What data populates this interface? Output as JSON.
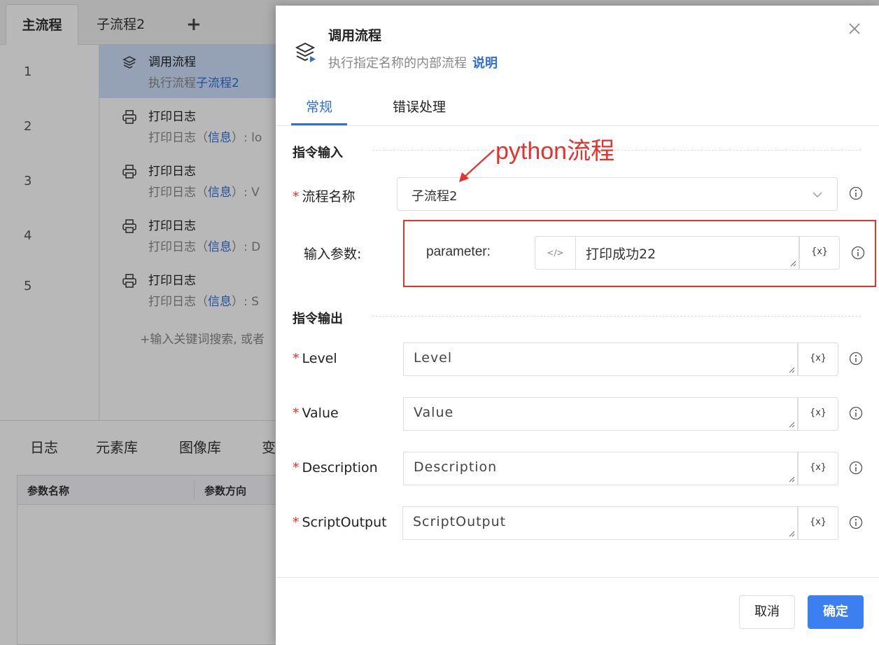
{
  "tabs": {
    "main": "主流程",
    "sub": "子流程2",
    "add": "+"
  },
  "line_numbers": [
    "1",
    "2",
    "3",
    "4",
    "5"
  ],
  "steps": [
    {
      "title": "调用流程",
      "sub_prefix": "执行流程",
      "sub_highlight": "子流程2",
      "sub_suffix": ""
    },
    {
      "title": "打印日志",
      "sub_prefix": "打印日志（",
      "sub_highlight": "信息",
      "sub_suffix": "）: lo"
    },
    {
      "title": "打印日志",
      "sub_prefix": "打印日志（",
      "sub_highlight": "信息",
      "sub_suffix": "）: V"
    },
    {
      "title": "打印日志",
      "sub_prefix": "打印日志（",
      "sub_highlight": "信息",
      "sub_suffix": "）: D"
    },
    {
      "title": "打印日志",
      "sub_prefix": "打印日志（",
      "sub_highlight": "信息",
      "sub_suffix": "）: S"
    }
  ],
  "add_hint": "+输入关键词搜索, 或者",
  "bottom_tabs": [
    "日志",
    "元素库",
    "图像库",
    "变"
  ],
  "param_table": {
    "col1": "参数名称",
    "col2": "参数方向"
  },
  "dialog": {
    "title": "调用流程",
    "subtitle": "执行指定名称的内部流程",
    "help_link": "说明",
    "tabs": {
      "general": "常规",
      "error": "错误处理"
    },
    "input_section": "指令输入",
    "output_section": "指令输出",
    "process_name_label": "流程名称",
    "process_name_value": "子流程2",
    "input_params_label": "输入参数:",
    "param_name": "parameter:",
    "param_value": "打印成功22",
    "code_btn": "</>",
    "var_btn": "{x}",
    "outputs": [
      {
        "label": "Level",
        "value": "Level"
      },
      {
        "label": "Value",
        "value": "Value"
      },
      {
        "label": "Description",
        "value": "Description"
      },
      {
        "label": "ScriptOutput",
        "value": "ScriptOutput"
      }
    ],
    "required_mark": "*",
    "cancel": "取消",
    "ok": "确定"
  },
  "annotation": {
    "text": "python流程",
    "color": "#e5322d"
  },
  "colors": {
    "accent": "#2f6fd8",
    "primary_button": "#3b7ff0",
    "selected_row": "#cfe1fb",
    "required": "#e5322d"
  }
}
